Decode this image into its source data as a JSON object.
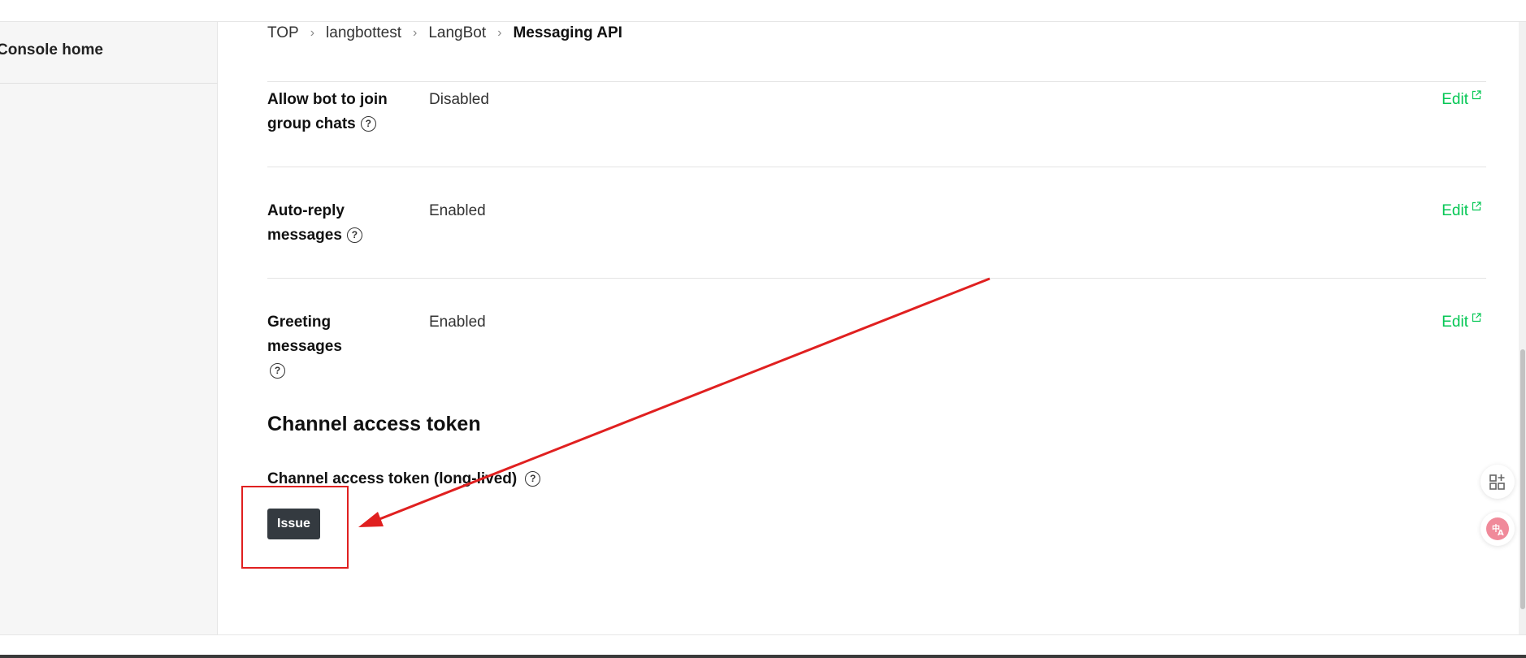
{
  "sidebar": {
    "home_label": "Console home"
  },
  "breadcrumb": {
    "items": [
      "TOP",
      "langbottest",
      "LangBot",
      "Messaging API"
    ],
    "separator": "›"
  },
  "settings": [
    {
      "label": "Allow bot to join group chats",
      "value": "Disabled",
      "edit_label": "Edit"
    },
    {
      "label": "Auto-reply messages",
      "value": "Enabled",
      "edit_label": "Edit"
    },
    {
      "label": "Greeting messages",
      "value": "Enabled",
      "edit_label": "Edit"
    }
  ],
  "token_section": {
    "title": "Channel access token",
    "token_label": "Channel access token (long-lived)",
    "issue_button": "Issue"
  },
  "colors": {
    "accent": "#06c755",
    "annotation": "#e02020",
    "button_bg": "#343a40"
  },
  "icons": [
    "help-icon",
    "external-link-icon",
    "qr-add-icon",
    "translate-icon"
  ]
}
